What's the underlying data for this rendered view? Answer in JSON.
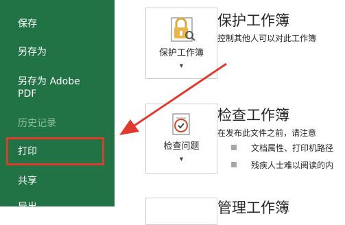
{
  "sidebar": {
    "items": [
      {
        "label": "保存"
      },
      {
        "label": "另存为"
      },
      {
        "label": "另存为 Adobe"
      },
      {
        "label": "PDF"
      },
      {
        "label": "历史记录"
      },
      {
        "label": "打印"
      },
      {
        "label": "共享"
      },
      {
        "label": "导出"
      }
    ],
    "bg_color": "#217346",
    "highlight_color": "#e03a2f"
  },
  "sections": {
    "protect": {
      "title": "保护工作簿",
      "desc": "控制其他人可以对此工作簿",
      "tile_label": "保护工作簿",
      "icon": "lock-key-icon"
    },
    "inspect": {
      "title": "检查工作簿",
      "desc": "在发布此文件之前，请注意",
      "tile_label": "检查问题",
      "icon": "inspect-document-icon",
      "bullets": [
        "文档属性、打印机路径",
        "残疾人士难以阅读的内"
      ]
    },
    "manage": {
      "title": "管理工作簿"
    }
  },
  "annotation": {
    "arrow_color": "#e03a2f"
  }
}
